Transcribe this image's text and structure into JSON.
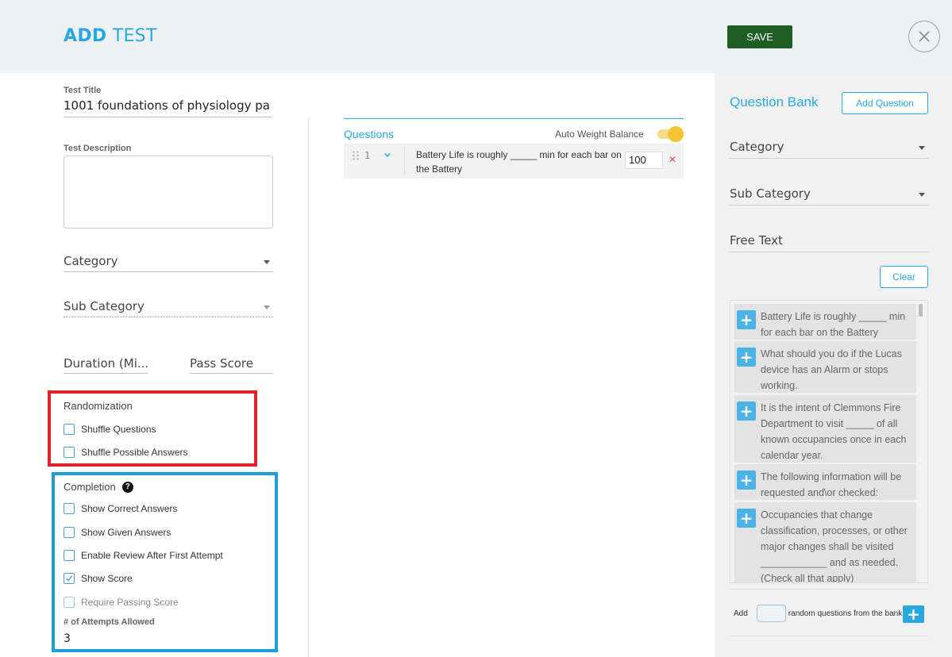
{
  "header": {
    "title_bold": "ADD",
    "title_rest": " TEST",
    "save_label": "SAVE"
  },
  "form": {
    "test_title_label": "Test Title",
    "test_title_value": "1001 foundations of physiology pa",
    "test_description_label": "Test Description",
    "category_label": "Category",
    "sub_category_label": "Sub Category",
    "duration_label": "Duration (Mi...",
    "pass_score_label": "Pass Score"
  },
  "randomization": {
    "title": "Randomization",
    "options": [
      {
        "label": "Shuffle Questions",
        "checked": false
      },
      {
        "label": "Shuffle Possible Answers",
        "checked": false
      }
    ]
  },
  "completion": {
    "title": "Completion",
    "options": [
      {
        "label": "Show Correct Answers",
        "checked": false
      },
      {
        "label": "Show Given Answers",
        "checked": false
      },
      {
        "label": "Enable Review After First Attempt",
        "checked": false
      },
      {
        "label": "Show Score",
        "checked": true
      },
      {
        "label": "Require Passing Score",
        "checked": false
      }
    ],
    "attempts_label": "# of Attempts Allowed",
    "attempts_value": "3"
  },
  "questions": {
    "title": "Questions",
    "auto_weight_label": "Auto Weight Balance",
    "auto_weight_on": true,
    "items": [
      {
        "number": "1",
        "text": "Battery Life is roughly _____ min for each bar on the Battery",
        "weight": "100"
      }
    ]
  },
  "bank": {
    "title": "Question Bank",
    "add_question_label": "Add Question",
    "category_label": "Category",
    "sub_category_label": "Sub Category",
    "free_text_label": "Free Text",
    "clear_label": "Clear",
    "items": [
      "Battery Life is roughly _____ min for each bar on the Battery",
      "What should you do if the Lucas device has an Alarm or stops working.",
      "It is the intent of Clemmons Fire Department to visit _____ of all known occupancies once in each calendar year.",
      "The following information will be requested and\\or checked:",
      "Occupancies that change classification, processes, or other major changes shall be visited ____________ and as needed. (Check all that apply)"
    ],
    "add_prefix": "Add",
    "add_suffix": "random questions from the bank"
  },
  "colors": {
    "accent": "#29a8e0",
    "save": "#1f5e22",
    "randomization_border": "#e3222e",
    "completion_border": "#1c9fd9",
    "toggle": "#f4c52e"
  }
}
